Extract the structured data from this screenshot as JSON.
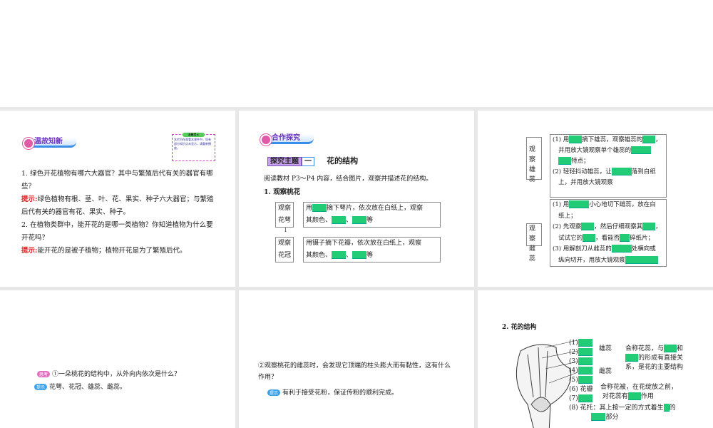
{
  "slide1": {
    "banner": "温故知新",
    "note_title": "温馨提示",
    "note_text": "本栏目在观看本课件中，如有部分知识点未显示，请重新播放。",
    "q1": "1. 绿色开花植物有哪六大器官？其中与繁殖后代有关的器官有哪些？",
    "hint_label": "提示:",
    "a1": "绿色植物有根、茎、叶、花、果实、种子六大器官；与繁殖后代有关的器官有花、果实、种子。",
    "q2": "2. 在植物类群中，能开花的是哪一类植物？你知道植物为什么要开花吗？",
    "a2": "能开花的是被子植物；植物开花是为了繁殖后代。"
  },
  "slide2": {
    "banner": "合作探究",
    "topic_label": "探究主题",
    "topic_num": "一",
    "topic_title": "花的结构",
    "intro": "阅读教材 P3～P4 内容，结合图片，观察并描述花的结构。",
    "section": "1. 观察桃花",
    "step1_label": "观察花萼",
    "step1_a": "用",
    "step1_b": "摘下萼片，依次放在白纸上，观察",
    "step1_c": "其颜色、",
    "step1_d": "、",
    "step1_e": "等",
    "step2_label": "观察花冠",
    "step2_a": "用镊子摘下花瓣，依次放在白纸上，观察",
    "step2_c": "其颜色、",
    "step2_d": "、",
    "step2_e": "等"
  },
  "slide3": {
    "label1": "观察雄蕊",
    "l1a": "(1) 用",
    "l1b": "摘下雄蕊，观察雄蕊的",
    "l1c": "，",
    "l1d": "并用放大镜观察单个雄蕊的",
    "l1e": "特点；",
    "l1f": "(2) 轻轻抖动雄蕊，让",
    "l1g": "落到白纸",
    "l1h": "上，并用放大镜观察",
    "label2": "观察雌蕊",
    "l2a": "(1) 用",
    "l2b": "小心地切下雌蕊，放在白",
    "l2c": "纸上；",
    "l2d": "(2) 先观察",
    "l2e": "，然后仔细观察其",
    "l2f": "，",
    "l2g": "试试它的",
    "l2h": "，看能否",
    "l2i": "碎纸片；",
    "l2j": "(3) 用解剖刀从雌蕊的",
    "l2k": "处横向或",
    "l2l": "纵向切开，用放大镜观察"
  },
  "slide4": {
    "think_tag": "思考",
    "question": "①一朵桃花的结构中，从外向内依次是什么？",
    "hint_tag": "提示",
    "answer": "花萼、花冠、雄蕊、雌蕊。"
  },
  "slide5": {
    "question": "②观察桃花的雌蕊时，会发现它顶端的柱头膨大而有黏性，这有什么作用？",
    "hint_tag": "提示",
    "answer": "有利于接受花粉，保证传粉的顺利完成。"
  },
  "slide6": {
    "section": "2. 花的结构",
    "n1": "(1)",
    "n2": "(2)",
    "n3": "(3)",
    "n4": "(4)",
    "n5": "(5)",
    "n6": "(6) 花瓣",
    "n7": "(7)",
    "n8": "(8) 花托：其上按一定的方式着生",
    "n8b": "的",
    "n8c": "部分",
    "stamen": "雄蕊",
    "pistil": "雌蕊",
    "core1": "合称花蕊，与",
    "core1b": "和",
    "core2": "的形成有直接关",
    "core3": "系，是花的主要结构",
    "peri1": "合称花被，在花绽放之前，",
    "peri2": "对花蕊有",
    "peri3": "作用"
  }
}
